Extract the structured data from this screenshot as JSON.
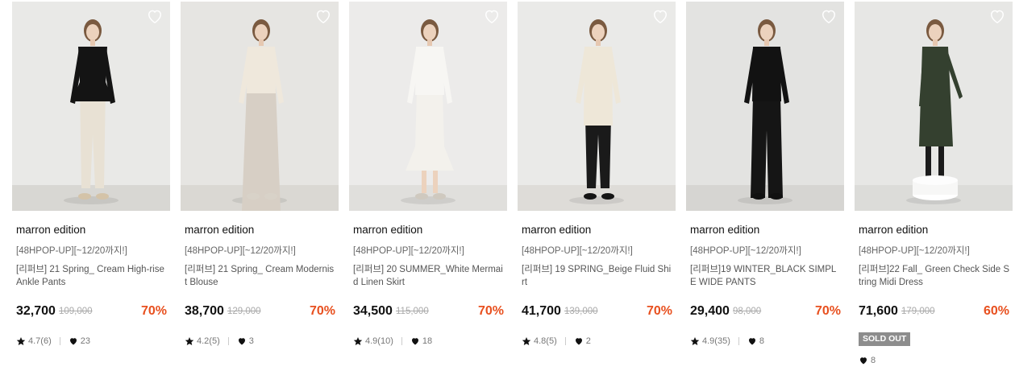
{
  "products": [
    {
      "brand": "marron edition",
      "tag": "[48HPOP-UP][~12/20까지!]",
      "name": "[리퍼브] 21 Spring_ Cream High-rise Ankle Pants",
      "price": "32,700",
      "original_price": "109,000",
      "discount": "70%",
      "rating": "4.7(6)",
      "likes": "23",
      "image": {
        "bg": "#e9e9e7",
        "floor": "#d8d7d3",
        "top": "#141414",
        "bottom": "#e8e1d4",
        "top_style": "peplum",
        "bottom_style": "pants",
        "shoes": "#d4c3a8"
      }
    },
    {
      "brand": "marron edition",
      "tag": "[48HPOP-UP][~12/20까지!]",
      "name": "[리퍼브] 21 Spring_ Cream Modernist Blouse",
      "price": "38,700",
      "original_price": "129,000",
      "discount": "70%",
      "rating": "4.2(5)",
      "likes": "3",
      "image": {
        "bg": "#e6e5e2",
        "floor": "#dad8d3",
        "top": "#efe8dc",
        "bottom": "#d7cfc5",
        "top_style": "blouse",
        "bottom_style": "skirt",
        "shoes": "#d8d2c8"
      }
    },
    {
      "brand": "marron edition",
      "tag": "[48HPOP-UP][~12/20까지!]",
      "name": "[리퍼브] 20 SUMMER_White Mermaid Linen Skirt",
      "price": "34,500",
      "original_price": "115,000",
      "discount": "70%",
      "rating": "4.9(10)",
      "likes": "18",
      "image": {
        "bg": "#ecebea",
        "floor": "#e0dfdc",
        "top": "#f7f6f3",
        "bottom": "#f3f1ec",
        "top_style": "tee",
        "bottom_style": "mermaid",
        "shoes": "#cfc9bf"
      }
    },
    {
      "brand": "marron edition",
      "tag": "[48HPOP-UP][~12/20까지!]",
      "name": "[리퍼브] 19 SPRING_Beige Fluid Shirt",
      "price": "41,700",
      "original_price": "139,000",
      "discount": "70%",
      "rating": "4.8(5)",
      "likes": "2",
      "image": {
        "bg": "#eaeae8",
        "floor": "#dedcd8",
        "top": "#eee7d8",
        "bottom": "#1a1a1a",
        "top_style": "longshirt",
        "bottom_style": "pants",
        "shoes": "#151515"
      }
    },
    {
      "brand": "marron edition",
      "tag": "[48HPOP-UP][~12/20까지!]",
      "name": "[리퍼브]19 WINTER_BLACK SIMPLE WIDE PANTS",
      "price": "29,400",
      "original_price": "98,000",
      "discount": "70%",
      "rating": "4.9(35)",
      "likes": "8",
      "image": {
        "bg": "#e3e3e1",
        "floor": "#d6d5d2",
        "top": "#121212",
        "bottom": "#151515",
        "top_style": "knit",
        "bottom_style": "wide",
        "shoes": "#111111"
      }
    },
    {
      "brand": "marron edition",
      "tag": "[48HPOP-UP][~12/20까지!]",
      "name": "[리퍼브]22 Fall_ Green Check Side String Midi Dress",
      "price": "71,600",
      "original_price": "179,000",
      "discount": "60%",
      "sold_out": "SOLD OUT",
      "likes": "8",
      "image": {
        "bg": "#e7e7e5",
        "floor": "#dcdcd9",
        "top": "#34402f",
        "bottom": "#34402f",
        "top_style": "dress",
        "bottom_style": "dress",
        "shoes": "#151515"
      }
    }
  ],
  "colors": {
    "discount": "#e8501f",
    "sold_out_bg": "#8d8d8d",
    "text": "#222222",
    "muted": "#777777"
  },
  "icons": {
    "wishlist": "heart-outline-icon",
    "rating": "star-icon",
    "likes": "heart-filled-icon"
  }
}
